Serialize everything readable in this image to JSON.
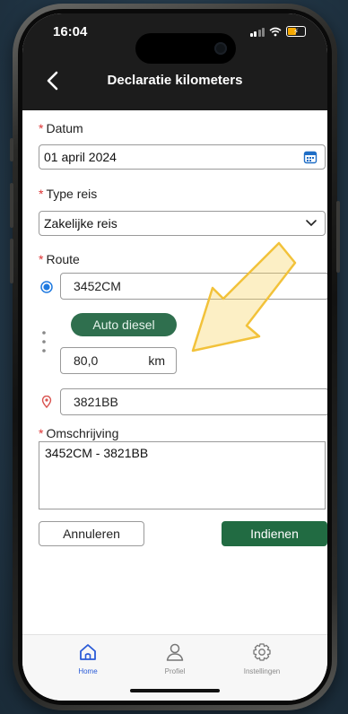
{
  "status_bar": {
    "time": "16:04"
  },
  "header": {
    "back_icon": "chevron-left-icon",
    "title": "Declaratie kilometers"
  },
  "form": {
    "required_marker": "*",
    "date": {
      "label": "Datum",
      "value": "01 april 2024",
      "icon": "calendar-icon"
    },
    "trip_type": {
      "label": "Type reis",
      "value": "Zakelijke reis",
      "icon": "chevron-down-icon"
    },
    "route": {
      "label": "Route",
      "origin": "3452CM",
      "vehicle": "Auto diesel",
      "distance_value": "80,0",
      "distance_unit": "km",
      "destination": "3821BB"
    },
    "description": {
      "label": "Omschrijving",
      "value": "3452CM - 3821BB"
    },
    "cancel_label": "Annuleren",
    "submit_label": "Indienen"
  },
  "tabs": [
    {
      "label": "Home",
      "icon": "home-icon",
      "active": true
    },
    {
      "label": "Profiel",
      "icon": "person-icon",
      "active": false
    },
    {
      "label": "Instellingen",
      "icon": "gear-icon",
      "active": false
    }
  ],
  "colors": {
    "header_bg": "#1c1c1c",
    "primary_green": "#216b42",
    "pill_green": "#2f6f4e",
    "required_red": "#dd3333",
    "radio_blue": "#1f7ae0",
    "active_tab": "#2a5bd7",
    "annotation_arrow": "#f6d25a"
  }
}
